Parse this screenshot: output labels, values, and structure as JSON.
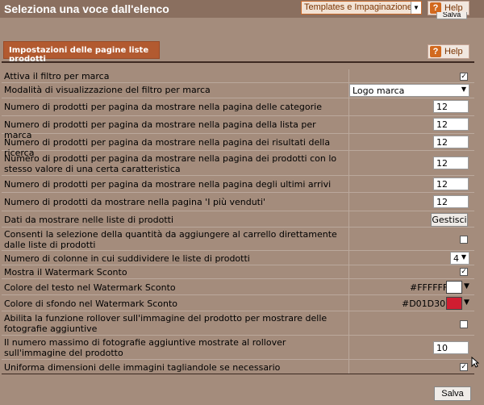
{
  "header": {
    "title": "Seleziona una voce dall'elenco",
    "select_value": "Templates e Impaginazione",
    "help_label": "Help",
    "help_icon": "?",
    "save_label": "Salva"
  },
  "section": {
    "title": "Impostazioni delle pagine liste prodotti",
    "help_label": "Help",
    "help_icon": "?"
  },
  "rows": [
    {
      "label": "Attiva il filtro per marca",
      "checked": true
    },
    {
      "label": "Modalità di visualizzazione del filtro per marca",
      "value": "Logo marca"
    },
    {
      "label": "Numero di prodotti per pagina da mostrare nella pagina delle categorie",
      "value": "12"
    },
    {
      "label": "Numero di prodotti per pagina da mostrare nella pagina della lista per marca",
      "value": "12"
    },
    {
      "label": "Numero di prodotti per pagina da mostrare nella pagina dei risultati della ricerca",
      "value": "12"
    },
    {
      "label": "Numero di prodotti per pagina da mostrare nella pagina dei prodotti con lo stesso valore di una certa caratteristica",
      "value": "12"
    },
    {
      "label": "Numero di prodotti per pagina da mostrare nella pagina degli ultimi arrivi",
      "value": "12"
    },
    {
      "label": "Numero di prodotti da mostrare nella pagina 'I più venduti'",
      "value": "12"
    },
    {
      "label": "Dati da mostrare nelle liste di prodotti",
      "button": "Gestisci"
    },
    {
      "label": "Consenti la selezione della quantità da aggiungere al carrello direttamente dalle liste di prodotti",
      "checked": false
    },
    {
      "label": "Numero di colonne in cui suddividere le liste di prodotti",
      "value": "4"
    },
    {
      "label": "Mostra il Watermark Sconto",
      "checked": true
    },
    {
      "label": "Colore del testo nel Watermark Sconto",
      "hex": "#FFFFFF",
      "color": "#FFFFFF"
    },
    {
      "label": "Colore di sfondo nel Watermark Sconto",
      "hex": "#D01D30",
      "color": "#D01D30"
    },
    {
      "label": "Abilita la funzione rollover sull'immagine del prodotto per mostrare delle fotografie aggiuntive",
      "checked": false
    },
    {
      "label": "Il numero massimo di fotografie aggiuntive mostrate al rollover sull'immagine del prodotto",
      "value": "10"
    },
    {
      "label": "Uniforma dimensioni delle immagini tagliandole se necessario",
      "checked": true
    }
  ],
  "footer": {
    "save_label": "Salva"
  },
  "colors": {
    "background": "#a48c7c",
    "section_tab": "#b25a30",
    "link": "#1a4fe0"
  }
}
